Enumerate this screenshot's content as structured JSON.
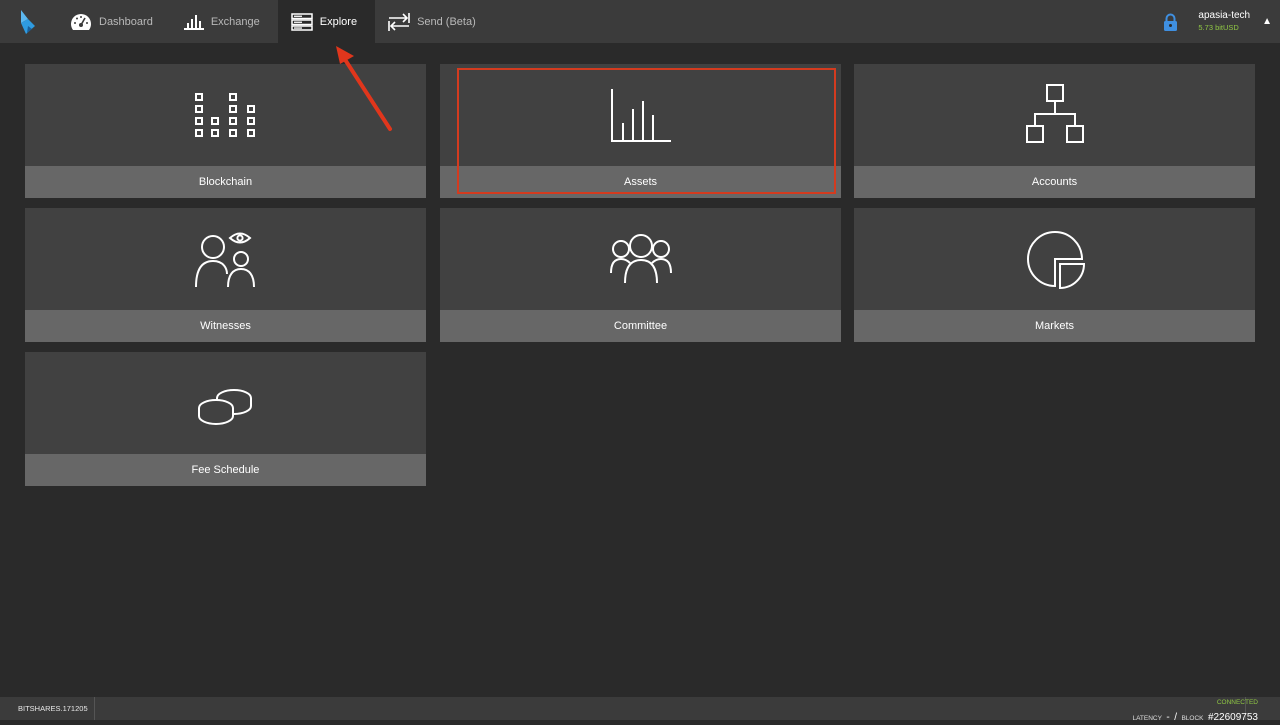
{
  "nav": {
    "items": [
      {
        "label": "Dashboard",
        "icon": "speedometer-icon"
      },
      {
        "label": "Exchange",
        "icon": "bar-chart-icon"
      },
      {
        "label": "Explore",
        "icon": "server-rack-icon",
        "active": true
      },
      {
        "label": "Send (Beta)",
        "icon": "transfer-arrows-icon"
      }
    ]
  },
  "account": {
    "name": "apasia-tech",
    "balance": "5.73 bitUSD",
    "caret": "▲"
  },
  "tiles": [
    {
      "label": "Blockchain",
      "icon": "blockchain-blocks-icon"
    },
    {
      "label": "Assets",
      "icon": "assets-chart-icon"
    },
    {
      "label": "Accounts",
      "icon": "account-tree-icon"
    },
    {
      "label": "Witnesses",
      "icon": "witnesses-people-eye-icon"
    },
    {
      "label": "Committee",
      "icon": "committee-group-icon"
    },
    {
      "label": "Markets",
      "icon": "markets-pie-icon"
    },
    {
      "label": "Fee Schedule",
      "icon": "coins-icon"
    }
  ],
  "footer": {
    "version": "BITSHARES.171205",
    "status": "CONNECTED",
    "latency_label": "LATENCY",
    "latency_value": "-",
    "separator": "/",
    "block_label": "BLOCK",
    "block_number": "#22609753"
  },
  "colors": {
    "accent_green": "#8fc744",
    "highlight_red": "#d33b1f",
    "logo_blue": "#2f9be0",
    "lock_blue": "#3f8fe0"
  }
}
